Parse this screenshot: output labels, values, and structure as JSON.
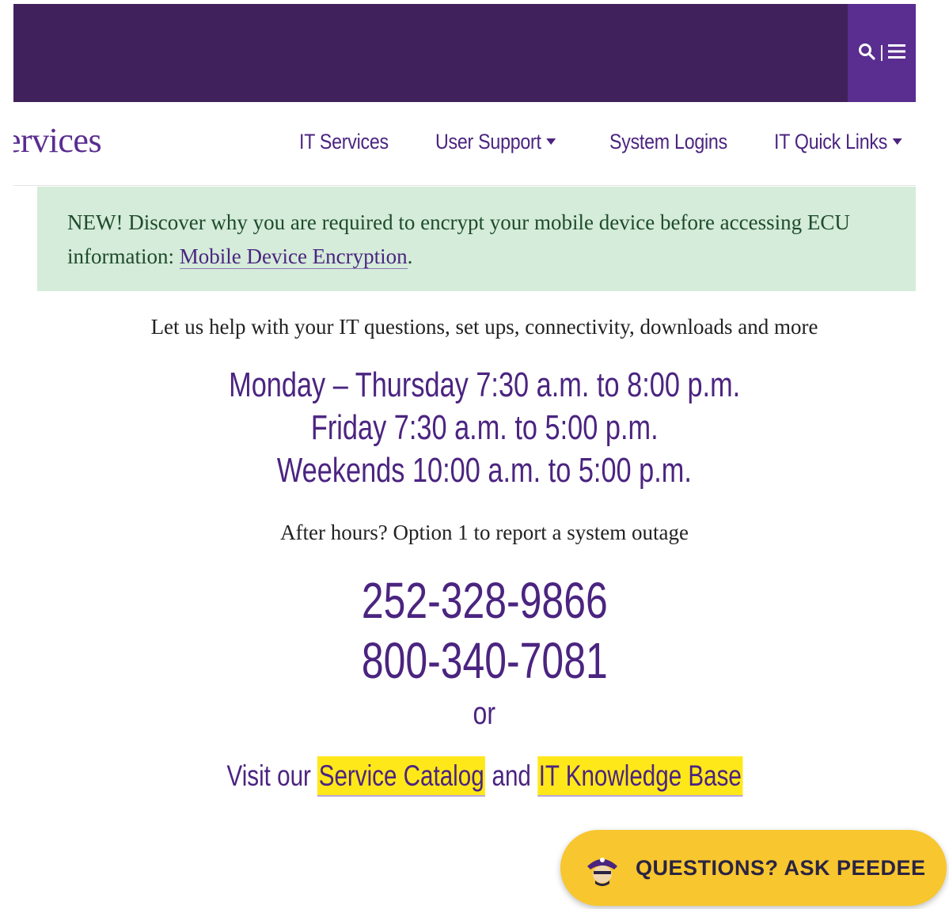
{
  "header": {
    "search_icon": "search-icon",
    "menu_icon": "hamburger-menu-icon",
    "colors": {
      "bar": "#41215c",
      "tools": "#5a2d90"
    }
  },
  "nav": {
    "brand_fragment": "ervices",
    "items": [
      {
        "label": "IT Services",
        "has_dropdown": false
      },
      {
        "label": "User Support",
        "has_dropdown": true
      },
      {
        "label": "System Logins",
        "has_dropdown": false
      },
      {
        "label": "IT Quick Links",
        "has_dropdown": true
      }
    ]
  },
  "alert": {
    "text": "NEW! Discover why you are required to encrypt your mobile device before accessing ECU information: ",
    "link_label": "Mobile Device Encryption",
    "trail": "."
  },
  "content": {
    "tagline": "Let us help with your IT questions, set ups, connectivity, downloads and more",
    "hours": [
      "Monday – Thursday 7:30 a.m. to 8:00 p.m.",
      "Friday 7:30 a.m. to 5:00 p.m.",
      "Weekends 10:00 a.m. to 5:00 p.m."
    ],
    "after_hours": "After hours? Option 1 to report a system outage",
    "phones": [
      "252-328-9866",
      "800-340-7081"
    ],
    "or": "or",
    "visit_prefix": "Visit our ",
    "service_catalog": "Service Catalog",
    "and": " and ",
    "knowledge_base": "IT Knowledge Base"
  },
  "chat": {
    "label": "QUESTIONS? ASK PEEDEE",
    "avatar_icon": "pirate-mascot-icon",
    "color": "#f8c62e"
  }
}
